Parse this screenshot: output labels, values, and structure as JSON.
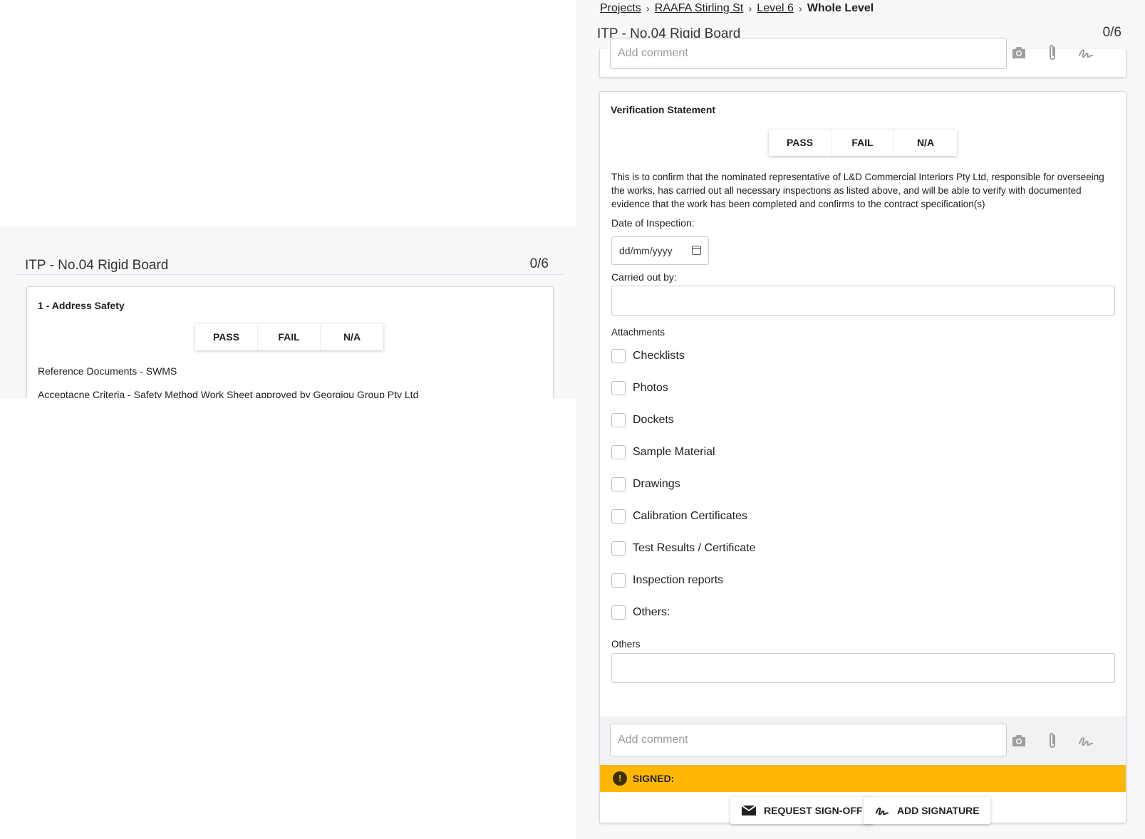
{
  "left": {
    "header": {
      "title": "ITP - No.04 Rigid Board",
      "count": "0/6"
    },
    "card": {
      "title": "1 - Address Safety",
      "options": [
        "PASS",
        "FAIL",
        "N/A"
      ],
      "reference": "Reference Documents - SWMS",
      "acceptance": "Acceptacne Criteria - Safety Method Work Sheet approved by Georgiou Group Pty Ltd"
    }
  },
  "right": {
    "breadcrumb": {
      "projects": "Projects",
      "project": "RAAFA Stirling St",
      "level": "Level 6",
      "current": "Whole Level"
    },
    "header": {
      "title": "ITP - No.04 Rigid Board",
      "count": "0/6"
    },
    "top_comment_placeholder": "Add comment",
    "verification": {
      "title": "Verification Statement",
      "options": [
        "PASS",
        "FAIL",
        "N/A"
      ],
      "statement": "This is to confirm that the nominated representative of L&D Commercial Interiors Pty Ltd, responsible for overseeing the works, has carried out all necessary inspections as listed above, and will be able to verify with documented evidence that the work has been completed and confirms to the contract specification(s)",
      "date_label": "Date of Inspection:",
      "date_placeholder": "dd/mm/yyyy",
      "carried_label": "Carried out by:",
      "attachments_label": "Attachments",
      "attachments": [
        "Checklists",
        "Photos",
        "Dockets",
        "Sample Material",
        "Drawings",
        "Calibration Certificates",
        "Test Results / Certificate",
        "Inspection reports",
        "Others:"
      ],
      "others_label": "Others",
      "comment_placeholder": "Add comment",
      "signed_label": "SIGNED:",
      "request_signoff": "REQUEST SIGN-OFF",
      "add_signature": "ADD SIGNATURE"
    }
  },
  "colors": {
    "signed_bar": "#ffb703",
    "background": "#f7f8fa"
  }
}
